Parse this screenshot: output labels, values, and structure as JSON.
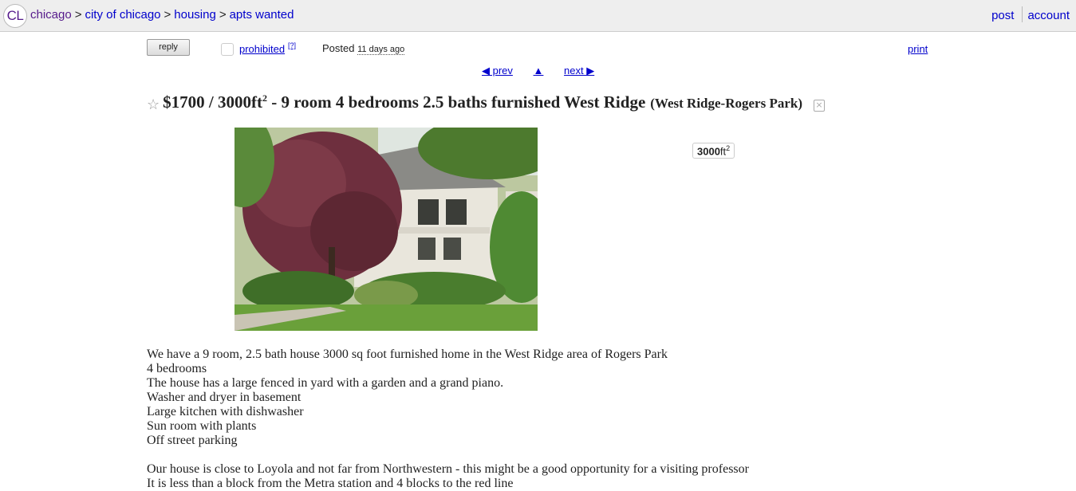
{
  "header": {
    "logo": "CL",
    "breadcrumbs": [
      "chicago",
      "city of chicago",
      "housing",
      "apts wanted"
    ],
    "separator": ">",
    "post_label": "post",
    "account_label": "account"
  },
  "actions": {
    "reply_label": "reply",
    "prohibited_label": "prohibited",
    "help_label": "[?]",
    "posted_label": "Posted",
    "posted_ago": "11 days ago",
    "print_label": "print",
    "prev_label": "◀ prev",
    "up_label": "▲",
    "next_label": "next ▶"
  },
  "listing": {
    "star": "☆",
    "price": "$1700",
    "size_prefix": " / 3000ft",
    "size_sup": "2",
    "title_text": " - 9 room 4 bedrooms 2.5 baths furnished West Ridge",
    "location": "(West Ridge-Rogers Park)",
    "attr_value": "3000",
    "attr_unit": "ft",
    "attr_sup": "2"
  },
  "body": {
    "lines": [
      "We have a 9 room, 2.5 bath house 3000 sq foot furnished home in the West Ridge area of Rogers Park",
      "4 bedrooms",
      "The house has a large fenced in yard with a garden and a grand piano.",
      "Washer and dryer in basement",
      "Large kitchen with dishwasher",
      "Sun room with plants",
      "Off street parking"
    ],
    "lines2": [
      "Our house is close to Loyola and not far from Northwestern - this might be a good opportunity for a visiting professor",
      "It is less than a block from the Metra station and 4 blocks to the red line"
    ]
  }
}
